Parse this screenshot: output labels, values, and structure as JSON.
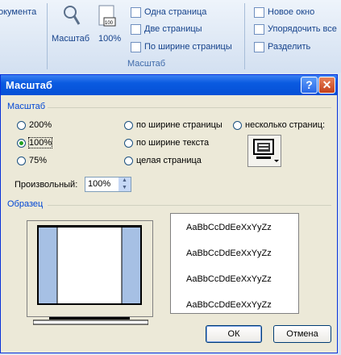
{
  "ribbon": {
    "left_cut_text": "окумента",
    "zoom_label": "Масштаб",
    "hundred_label": "100%",
    "one_page": "Одна страница",
    "two_pages": "Две страницы",
    "page_width": "По ширине страницы",
    "group_label": "Масштаб",
    "new_window": "Новое окно",
    "arrange_all": "Упорядочить все",
    "split": "Разделить"
  },
  "dialog": {
    "title": "Масштаб",
    "help_glyph": "?",
    "close_glyph": "✕",
    "zoom_section": "Масштаб",
    "radios": {
      "r200": "200%",
      "r100": "100%",
      "r75": "75%",
      "page_width": "по ширине страницы",
      "text_width": "по ширине текста",
      "whole_page": "целая страница",
      "many_pages": "несколько страниц:"
    },
    "selected": "100%",
    "arbitrary_label": "Произвольный:",
    "arbitrary_value": "100%",
    "sample_section": "Образец",
    "sample_text": "AaBbCcDdEeXxYyZz",
    "ok": "ОК",
    "cancel": "Отмена"
  }
}
